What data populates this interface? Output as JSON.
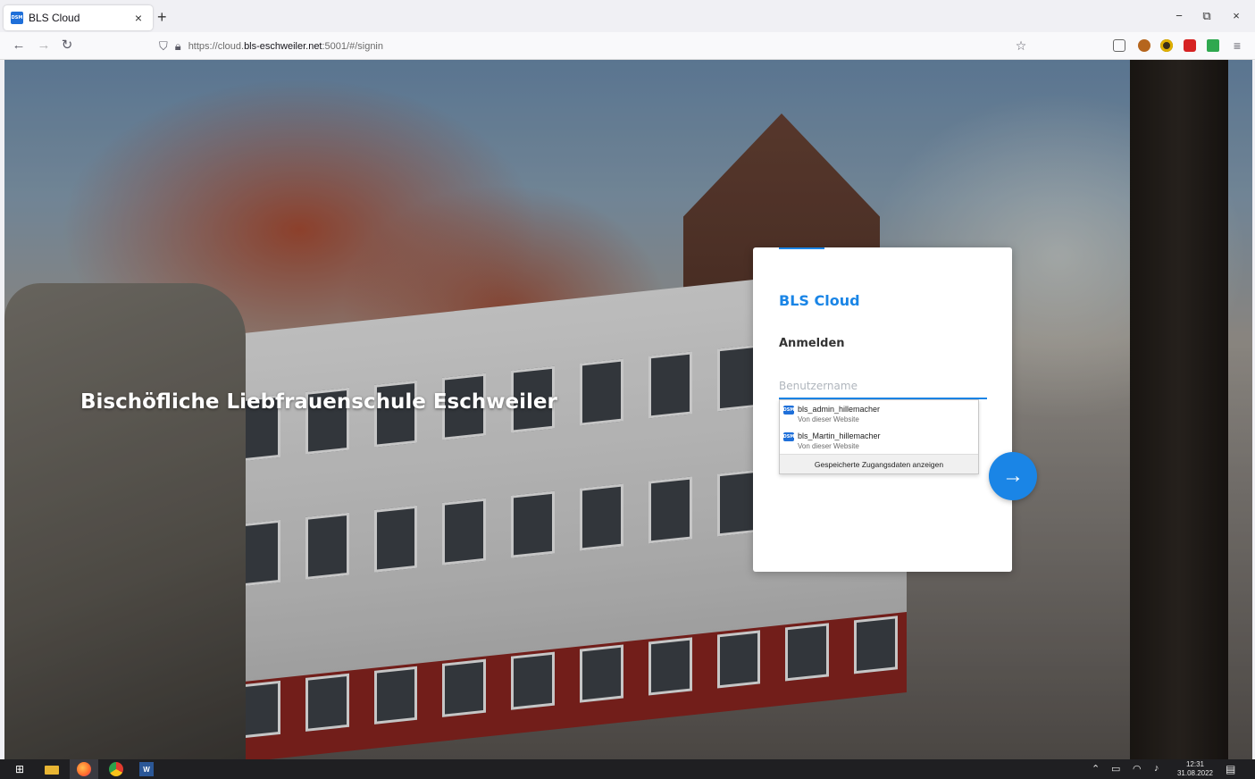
{
  "browser": {
    "tab": {
      "favicon": "DSM",
      "title": "BLS Cloud",
      "close": "×"
    },
    "new_tab": "+",
    "window": {
      "minimize": "−",
      "restore": "⧉",
      "close": "×"
    },
    "nav": {
      "back": "←",
      "forward": "→",
      "reload": "↻"
    },
    "url": {
      "prefix": "https://cloud.",
      "host": "bls-eschweiler.net",
      "suffix": ":5001/#/signin"
    },
    "toolbar_icons": [
      "pocket-icon",
      "extension-icon",
      "extension-icon",
      "ublock-icon",
      "extension-icon",
      "menu-icon"
    ],
    "menu": "≡",
    "bookmark": "☆"
  },
  "page": {
    "school_title": "Bischöfliche Liebfrauenschule Eschweiler",
    "card": {
      "app_title": "BLS Cloud",
      "signin_title": "Anmelden",
      "username_placeholder": "Benutzername",
      "next_button": "→"
    },
    "autocomplete": {
      "items": [
        {
          "favicon": "DSM",
          "user": "bls_admin_hillemacher",
          "source": "Von dieser Website"
        },
        {
          "favicon": "DSM",
          "user": "bls_Martin_hillemacher",
          "source": "Von dieser Website"
        }
      ],
      "footer": "Gespeicherte Zugangsdaten anzeigen"
    }
  },
  "taskbar": {
    "time": "12:31",
    "date": "31.08.2022"
  },
  "colors": {
    "accent": "#1a85e6",
    "taskbar": "#1f1f22"
  }
}
